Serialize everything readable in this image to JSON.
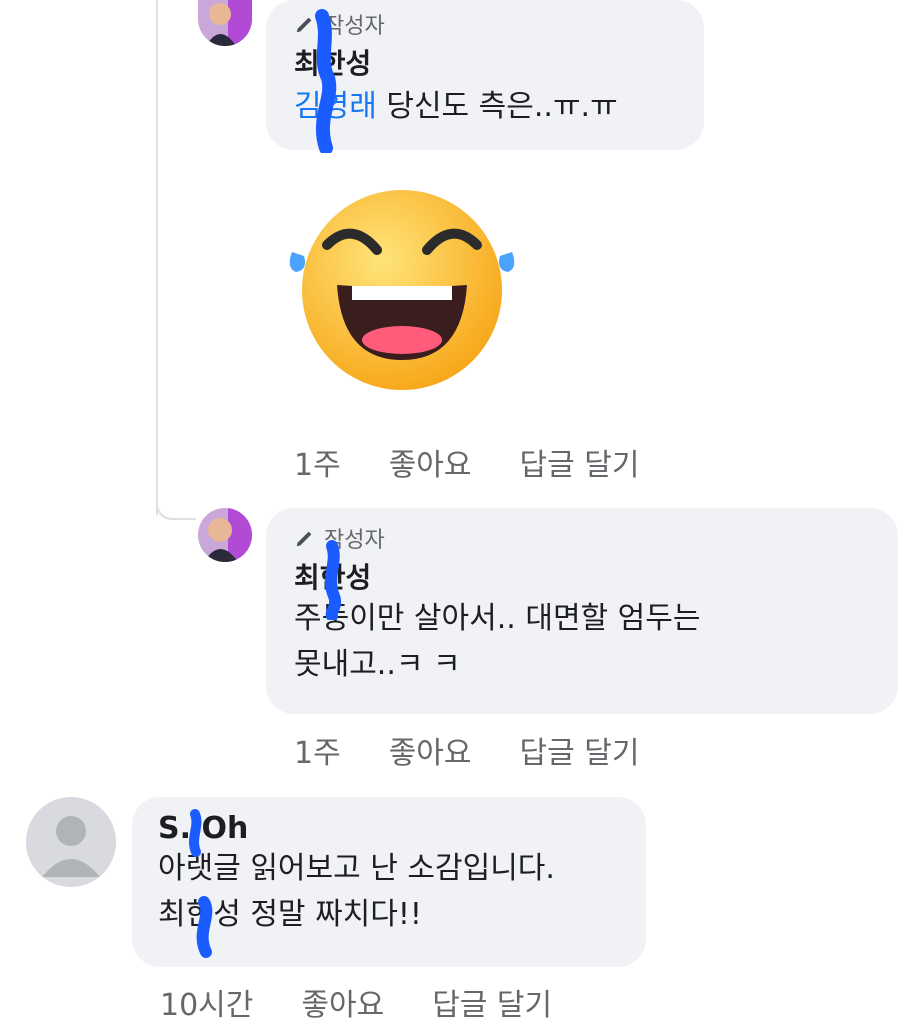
{
  "comments": [
    {
      "author_badge": "작성자",
      "name": "최한성",
      "mention": "김영래",
      "text": " 당신도 측은..ㅠ.ㅠ"
    },
    {
      "emoji": "laughing-tears-emoji",
      "time": "1주",
      "like": "좋아요",
      "reply": "답글 달기"
    },
    {
      "author_badge": "작성자",
      "name": "최한성",
      "text_line1": "주둥이만 살아서.. 대면할 엄두는",
      "text_line2": "못내고..ㅋ ㅋ",
      "time": "1주",
      "like": "좋아요",
      "reply": "답글 달기"
    },
    {
      "name": "S. Oh",
      "text_line1": "아랫글 읽어보고 난 소감입니다.",
      "text_line2": "최한성 정말 짜치다!!",
      "time": "10시간",
      "like": "좋아요",
      "reply": "답글 달기"
    }
  ],
  "colors": {
    "bubble": "#f0f2f5",
    "mention": "#1877f2",
    "meta": "#65676b",
    "scribble": "#1a5cff"
  }
}
